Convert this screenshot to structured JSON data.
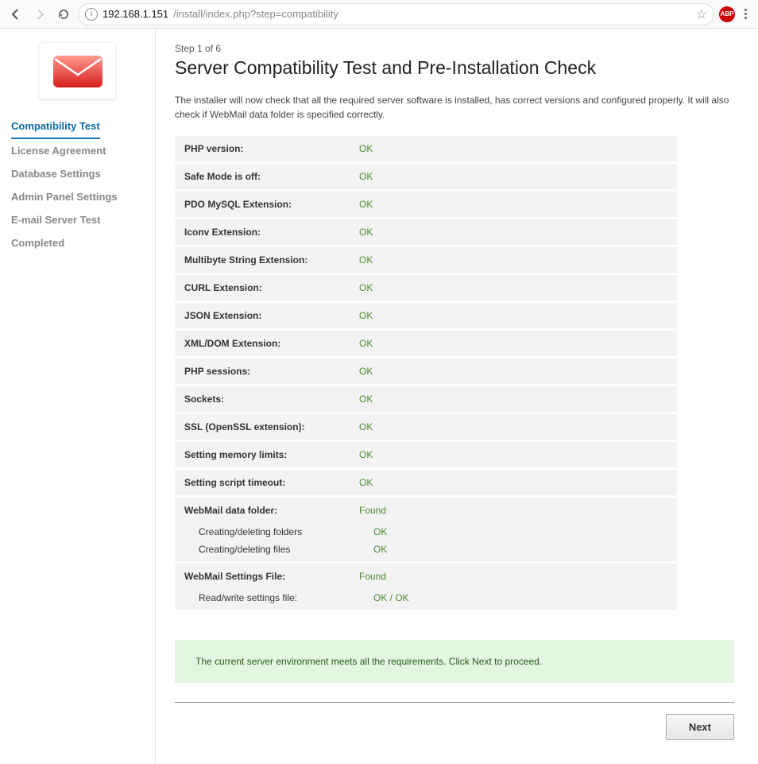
{
  "browser": {
    "url_host": "192.168.1.151",
    "url_path": "/install/index.php?step=compatibility"
  },
  "sidebar": {
    "items": [
      {
        "label": "Compatibility Test",
        "active": true
      },
      {
        "label": "License Agreement",
        "active": false
      },
      {
        "label": "Database Settings",
        "active": false
      },
      {
        "label": "Admin Panel Settings",
        "active": false
      },
      {
        "label": "E-mail Server Test",
        "active": false
      },
      {
        "label": "Completed",
        "active": false
      }
    ]
  },
  "main": {
    "step": "Step 1 of 6",
    "title": "Server Compatibility Test and Pre-Installation Check",
    "intro": "The installer will now check that all the required server software is installed, has correct versions and configured properly. It will also check if WebMail data folder is specified correctly.",
    "checks": [
      {
        "label": "PHP version:",
        "value": "OK"
      },
      {
        "label": "Safe Mode is off:",
        "value": "OK"
      },
      {
        "label": "PDO MySQL Extension:",
        "value": "OK"
      },
      {
        "label": "Iconv Extension:",
        "value": "OK"
      },
      {
        "label": "Multibyte String Extension:",
        "value": "OK"
      },
      {
        "label": "CURL Extension:",
        "value": "OK"
      },
      {
        "label": "JSON Extension:",
        "value": "OK"
      },
      {
        "label": "XML/DOM Extension:",
        "value": "OK"
      },
      {
        "label": "PHP sessions:",
        "value": "OK"
      },
      {
        "label": "Sockets:",
        "value": "OK"
      },
      {
        "label": "SSL (OpenSSL extension):",
        "value": "OK"
      },
      {
        "label": "Setting memory limits:",
        "value": "OK"
      },
      {
        "label": "Setting script timeout:",
        "value": "OK"
      }
    ],
    "group1": {
      "head": {
        "label": "WebMail data folder:",
        "value": "Found"
      },
      "sub": [
        {
          "label": "Creating/deleting folders",
          "value": "OK"
        },
        {
          "label": "Creating/deleting files",
          "value": "OK"
        }
      ]
    },
    "group2": {
      "head": {
        "label": "WebMail Settings File:",
        "value": "Found"
      },
      "sub": [
        {
          "label": "Read/write settings file:",
          "value": "OK / OK"
        }
      ]
    },
    "ok_message": "The current server environment meets all the requirements. Click Next to proceed.",
    "next_label": "Next"
  }
}
